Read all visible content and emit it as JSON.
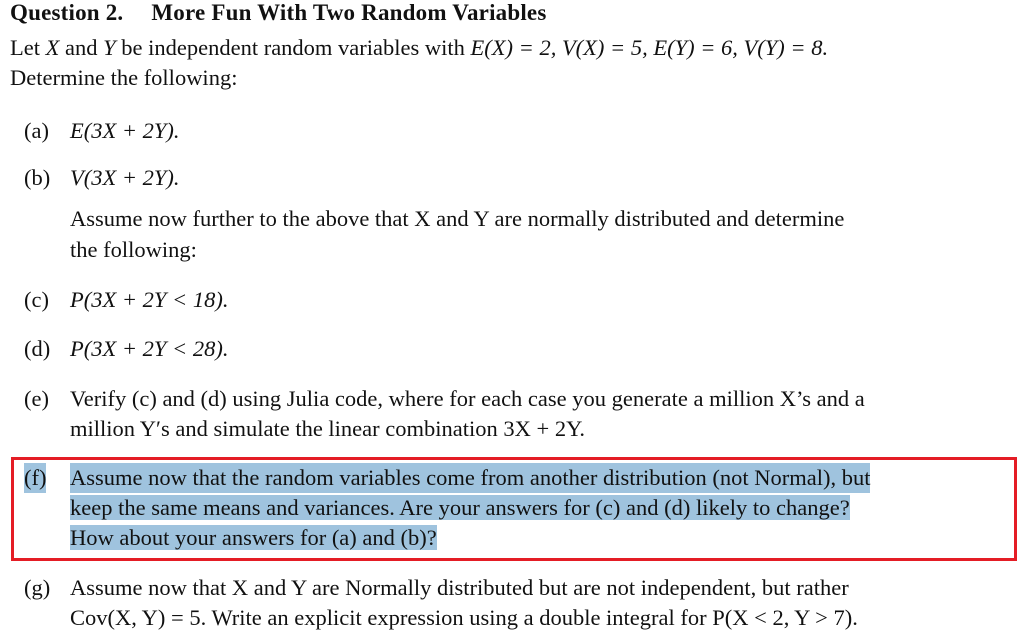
{
  "question": {
    "number_label": "Question 2.",
    "title": "More Fun With Two Random Variables"
  },
  "intro": {
    "line1_a": "Let ",
    "var_x": "X",
    "line1_b": " and ",
    "var_y": "Y",
    "line1_c": " be independent random variables with ",
    "line1_math": "E(X) = 2, V(X) = 5, E(Y) = 6,  V(Y) = 8.",
    "line2": "Determine the following:"
  },
  "parts": {
    "a": {
      "label": "(a)",
      "text": "E(3X + 2Y)."
    },
    "b": {
      "label": "(b)",
      "text": "V(3X + 2Y)."
    },
    "assume_normal": {
      "line1": "Assume now further to the above that X and Y are normally distributed and determine",
      "line2": "the following:"
    },
    "c": {
      "label": "(c)",
      "text": "P(3X + 2Y < 18)."
    },
    "d": {
      "label": "(d)",
      "text": "P(3X + 2Y < 28)."
    },
    "e": {
      "label": "(e)",
      "line1": "Verify (c) and (d) using Julia code, where for each case you generate a million X’s and a",
      "line2": "million Y′s and simulate the linear combination 3X + 2Y."
    },
    "f": {
      "label": "(f)",
      "line1": "Assume now that the random variables come from another distribution (not Normal), but",
      "line2": "keep the same means and variances.  Are your answers for (c) and (d) likely to change?",
      "line3": "How about your answers for (a) and (b)?"
    },
    "g": {
      "label": "(g)",
      "line1": "Assume now that X and Y are Normally distributed but are not independent, but rather",
      "line2": "Cov(X, Y) = 5. Write an explicit expression using a double integral for P(X < 2, Y > 7)."
    }
  },
  "highlight": {
    "selection_color": "#9fc3de",
    "box_color": "#e41d25"
  }
}
